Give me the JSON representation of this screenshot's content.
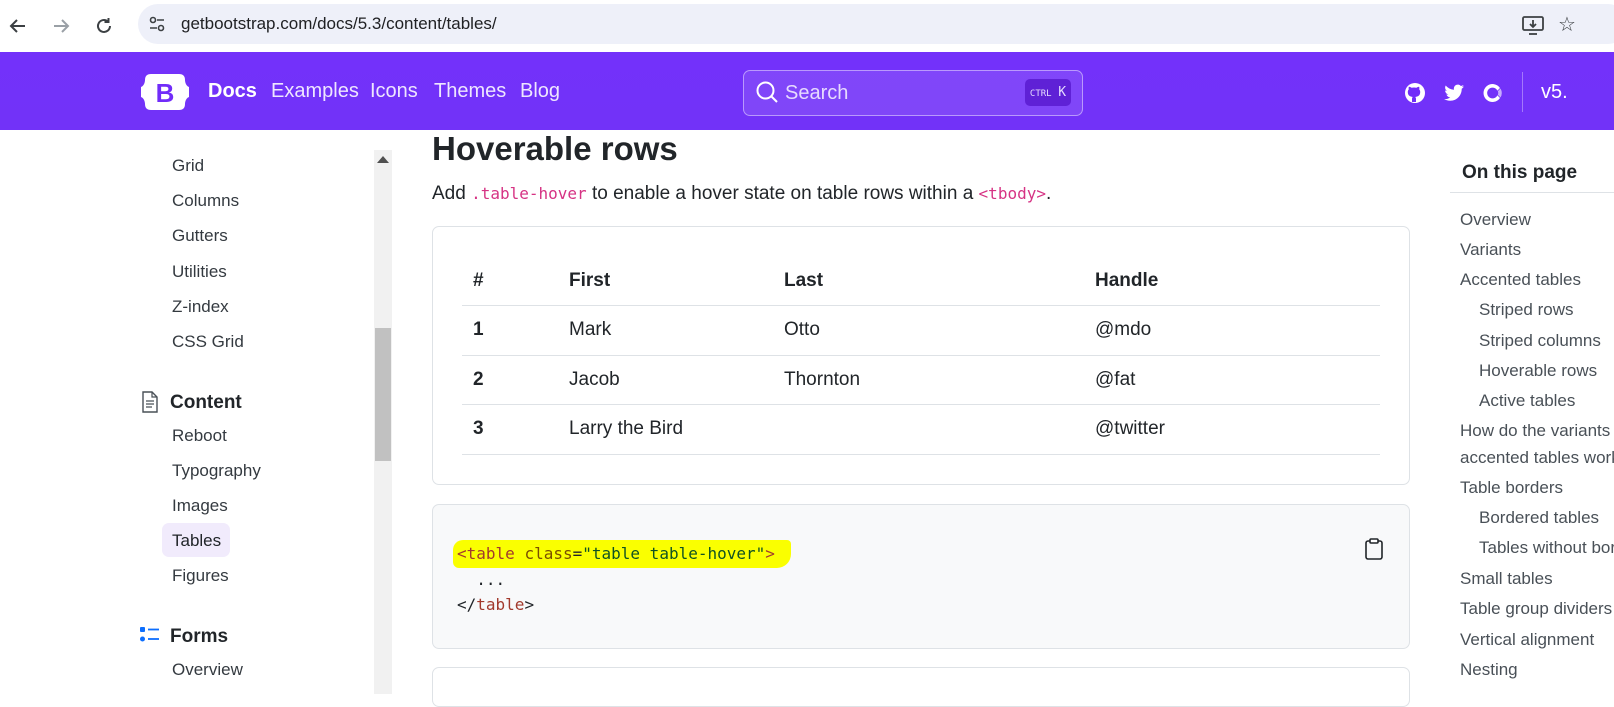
{
  "browser": {
    "url": "getbootstrap.com/docs/5.3/content/tables/"
  },
  "navbar": {
    "links": [
      "Docs",
      "Examples",
      "Icons",
      "Themes",
      "Blog"
    ],
    "search_placeholder": "Search",
    "shortcut_ctrl": "CTRL",
    "shortcut_key": "K",
    "version": "v5.",
    "brand_color": "#712cf9"
  },
  "sidebar": {
    "layout_items": [
      "Grid",
      "Columns",
      "Gutters",
      "Utilities",
      "Z-index",
      "CSS Grid"
    ],
    "content_heading": "Content",
    "content_items": [
      "Reboot",
      "Typography",
      "Images",
      "Tables",
      "Figures"
    ],
    "active_item": "Tables",
    "forms_heading": "Forms",
    "forms_items": [
      "Overview"
    ]
  },
  "main": {
    "title": "Hoverable rows",
    "lead_prefix": "Add ",
    "lead_code1": ".table-hover",
    "lead_middle": " to enable a hover state on table rows within a ",
    "lead_code2": "<tbody>",
    "lead_suffix": ".",
    "table": {
      "headers": [
        "#",
        "First",
        "Last",
        "Handle"
      ],
      "rows": [
        [
          "1",
          "Mark",
          "Otto",
          "@mdo"
        ],
        [
          "2",
          "Jacob",
          "Thornton",
          "@fat"
        ],
        [
          "3",
          "Larry the Bird",
          "",
          "@twitter"
        ]
      ]
    },
    "code": {
      "line1_open": "<",
      "line1_tag": "table",
      "line1_attr": " class",
      "line1_eq": "=",
      "line1_str": "\"table table-hover\"",
      "line1_close": ">",
      "line2": "  ...",
      "line3_open": "</",
      "line3_tag": "table",
      "line3_close": ">"
    }
  },
  "toc": {
    "title": "On this page",
    "items": [
      {
        "label": "Overview",
        "indent": false
      },
      {
        "label": "Variants",
        "indent": false
      },
      {
        "label": "Accented tables",
        "indent": false
      },
      {
        "label": "Striped rows",
        "indent": true
      },
      {
        "label": "Striped columns",
        "indent": true
      },
      {
        "label": "Hoverable rows",
        "indent": true
      },
      {
        "label": "Active tables",
        "indent": true
      },
      {
        "label": "How do the variants and",
        "indent": false
      },
      {
        "label": "accented tables work?",
        "indent": false
      },
      {
        "label": "Table borders",
        "indent": false
      },
      {
        "label": "Bordered tables",
        "indent": true
      },
      {
        "label": "Tables without borders",
        "indent": true
      },
      {
        "label": "Small tables",
        "indent": false
      },
      {
        "label": "Table group dividers",
        "indent": false
      },
      {
        "label": "Vertical alignment",
        "indent": false
      },
      {
        "label": "Nesting",
        "indent": false
      }
    ]
  }
}
